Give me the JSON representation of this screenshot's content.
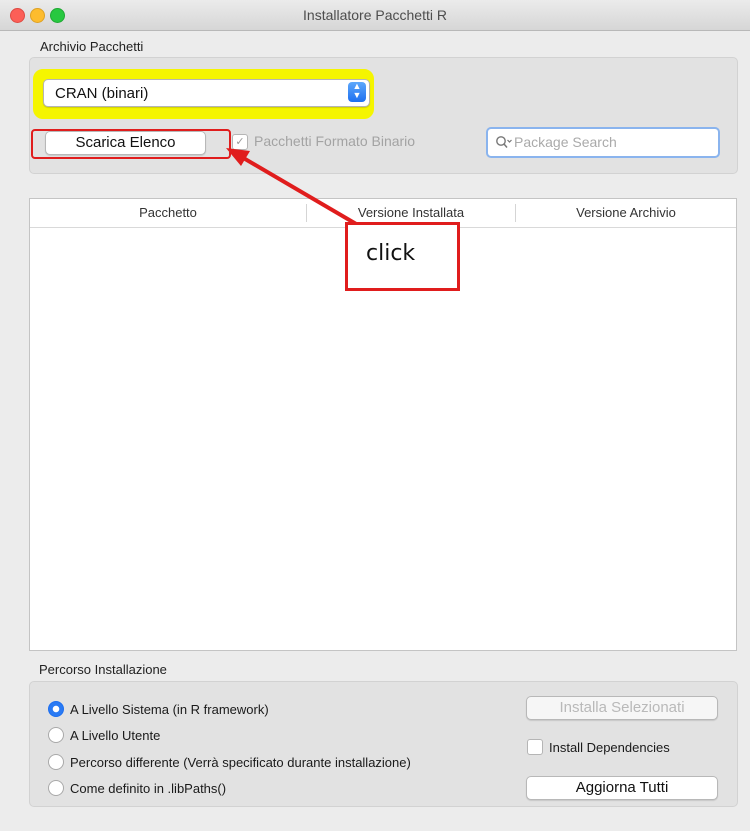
{
  "window": {
    "title": "Installatore Pacchetti R"
  },
  "repository": {
    "section_label": "Archivio Pacchetti",
    "selected": "CRAN (binari)",
    "download_button": "Scarica Elenco",
    "binary_checkbox_label": "Pacchetti Formato Binario",
    "binary_checked": true,
    "search_placeholder": "Package Search"
  },
  "table": {
    "columns": [
      "Pacchetto",
      "Versione Installata",
      "Versione Archivio"
    ],
    "rows": []
  },
  "annotation": {
    "text": "click",
    "color": "#e01d1d"
  },
  "install": {
    "section_label": "Percorso Installazione",
    "options": [
      {
        "label": "A Livello Sistema (in R framework)",
        "selected": true
      },
      {
        "label": "A Livello Utente",
        "selected": false
      },
      {
        "label": "Percorso differente (Verrà specificato durante installazione)",
        "selected": false
      },
      {
        "label": "Come definito in .libPaths()",
        "selected": false
      }
    ],
    "install_selected_button": "Installa Selezionati",
    "dependencies_label": "Install Dependencies",
    "dependencies_checked": false,
    "update_all_button": "Aggiorna Tutti"
  },
  "icons": {
    "search": "search-icon",
    "stepper": "chevron-updown-icon",
    "check": "checkmark-icon"
  },
  "colors": {
    "highlight": "#f5f500",
    "accent": "#1d6ff0"
  }
}
